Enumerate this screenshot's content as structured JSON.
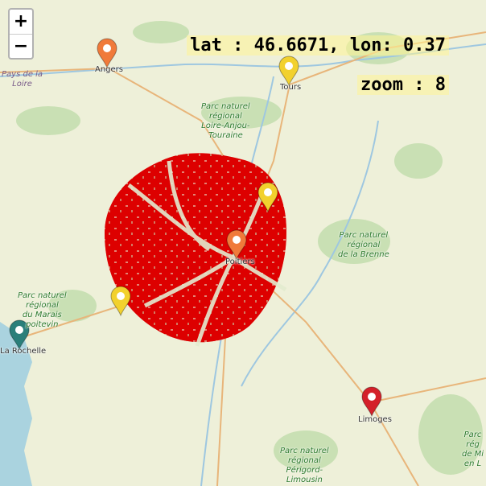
{
  "zoom_controls": {
    "zoom_in": "+",
    "zoom_out": "−"
  },
  "readout": {
    "coords": "lat : 46.6671, lon: 0.37",
    "zoom": "zoom : 8"
  },
  "places": {
    "angers": "Angers",
    "tours": "Tours",
    "poitiers": "Poitiers",
    "la_rochelle": "La Rochelle",
    "limoges": "Limoges"
  },
  "regions": {
    "pays_de_la_loire": "Pays de la\nLoire"
  },
  "parks": {
    "loire_anjou": "Parc naturel\nrégional\nLoire-Anjou-\nTouraine",
    "brenne": "Parc naturel\nrégional\nde la Brenne",
    "marais_poitevin": "Parc naturel\nrégional\ndu Marais\npoitevin",
    "perigord": "Parc naturel\nrégional\nPérigord-\nLimousin",
    "millevaches": "Parc\nrég\nde Mi\nen L"
  },
  "markers": [
    {
      "name": "marker-angers",
      "color": "#f07a3a"
    },
    {
      "name": "marker-tours",
      "color": "#f2d12e"
    },
    {
      "name": "marker-chatellerault",
      "color": "#f2d12e"
    },
    {
      "name": "marker-poitiers",
      "color": "#f07a3a"
    },
    {
      "name": "marker-niort",
      "color": "#f2d12e"
    },
    {
      "name": "marker-la-rochelle",
      "color": "#2a7f7a"
    },
    {
      "name": "marker-limoges",
      "color": "#d4202a"
    }
  ],
  "colors": {
    "overlay": "#dd0000",
    "sea": "#aad3df",
    "land": "#eef0d9",
    "forest": "#c9e0b4",
    "river": "#9ec7e0",
    "road": "#e8b57a"
  }
}
